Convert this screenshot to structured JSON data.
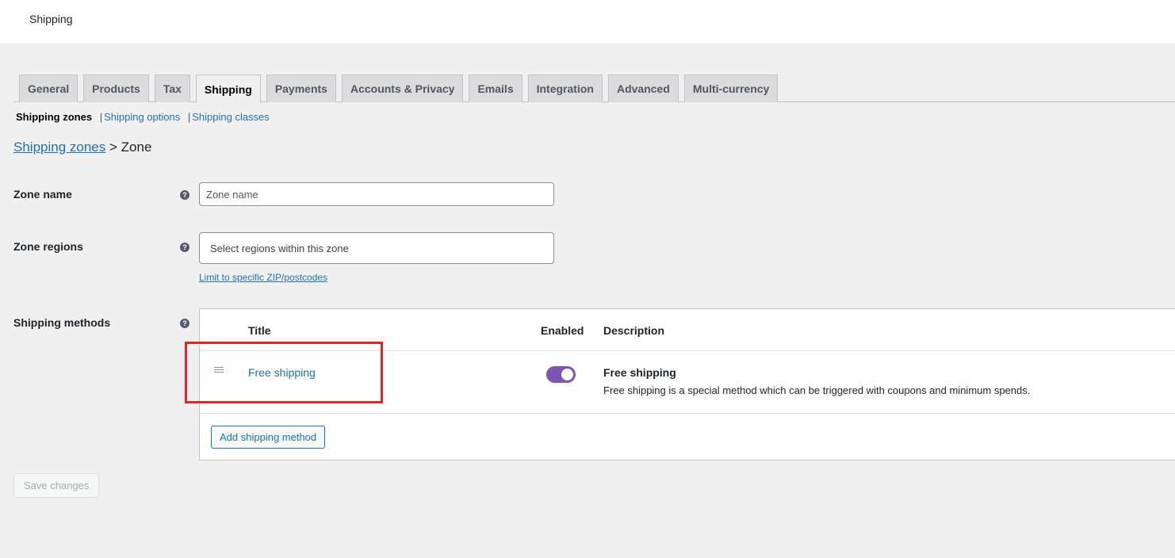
{
  "page_title": "Shipping",
  "tabs": [
    {
      "label": "General",
      "active": false
    },
    {
      "label": "Products",
      "active": false
    },
    {
      "label": "Tax",
      "active": false
    },
    {
      "label": "Shipping",
      "active": true
    },
    {
      "label": "Payments",
      "active": false
    },
    {
      "label": "Accounts & Privacy",
      "active": false
    },
    {
      "label": "Emails",
      "active": false
    },
    {
      "label": "Integration",
      "active": false
    },
    {
      "label": "Advanced",
      "active": false
    },
    {
      "label": "Multi-currency",
      "active": false
    }
  ],
  "subnav": {
    "current": "Shipping zones",
    "sep": "|",
    "options": "Shipping options",
    "classes": "Shipping classes"
  },
  "breadcrumb": {
    "link": "Shipping zones",
    "separator": ">",
    "current": "Zone"
  },
  "help_glyph": "?",
  "form": {
    "zone_name": {
      "label": "Zone name",
      "placeholder": "Zone name",
      "value": ""
    },
    "zone_regions": {
      "label": "Zone regions",
      "placeholder": "Select regions within this zone",
      "limit_link": "Limit to specific ZIP/postcodes"
    },
    "shipping_methods": {
      "label": "Shipping methods"
    }
  },
  "methods_table": {
    "headers": {
      "title": "Title",
      "enabled": "Enabled",
      "description": "Description"
    },
    "rows": [
      {
        "title": "Free shipping",
        "enabled": true,
        "description_title": "Free shipping",
        "description_text": "Free shipping is a special method which can be triggered with coupons and minimum spends."
      }
    ],
    "add_button": "Add shipping method"
  },
  "save_button": "Save changes",
  "colors": {
    "accent": "#2271b1",
    "toggle_on": "#7f54b3",
    "highlight": "#e32525",
    "background": "#f0f0f1"
  }
}
